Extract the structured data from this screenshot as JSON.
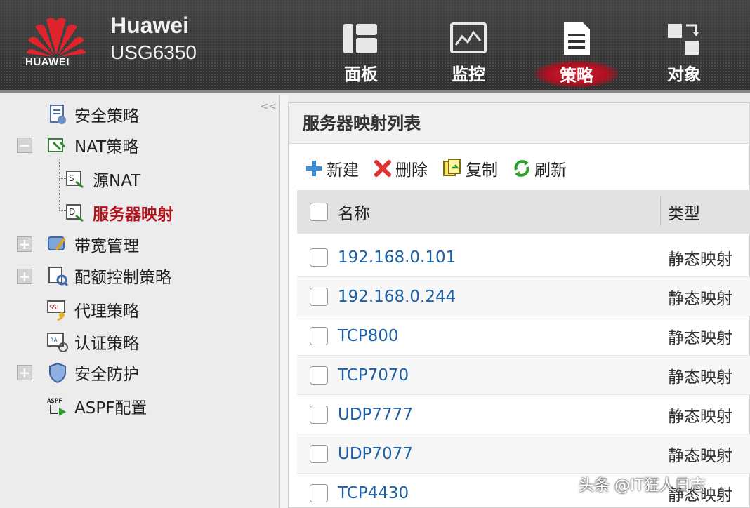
{
  "header": {
    "logo_text": "HUAWEI",
    "brand_name": "Huawei",
    "model": "USG6350",
    "nav": [
      {
        "label": "面板",
        "icon": "dashboard-icon",
        "active": false
      },
      {
        "label": "监控",
        "icon": "monitor-icon",
        "active": false
      },
      {
        "label": "策略",
        "icon": "policy-document-icon",
        "active": true
      },
      {
        "label": "对象",
        "icon": "object-icon",
        "active": false
      }
    ]
  },
  "sidebar": {
    "collapse_symbol": "<<",
    "items": [
      {
        "label": "安全策略",
        "icon": "security-policy-icon"
      },
      {
        "label": "NAT策略",
        "icon": "nat-policy-icon",
        "toggle": "−"
      },
      {
        "label": "源NAT",
        "icon": "source-nat-icon"
      },
      {
        "label": "服务器映射",
        "icon": "server-mapping-icon",
        "active": true
      },
      {
        "label": "带宽管理",
        "icon": "bandwidth-icon",
        "toggle": "+"
      },
      {
        "label": "配额控制策略",
        "icon": "quota-icon",
        "toggle": "+"
      },
      {
        "label": "代理策略",
        "icon": "ssl-proxy-icon"
      },
      {
        "label": "认证策略",
        "icon": "auth-icon"
      },
      {
        "label": "安全防护",
        "icon": "shield-icon",
        "toggle": "+"
      },
      {
        "label": "ASPF配置",
        "icon": "aspf-icon"
      }
    ]
  },
  "main": {
    "title": "服务器映射列表",
    "toolbar": {
      "new_label": "新建",
      "delete_label": "删除",
      "copy_label": "复制",
      "refresh_label": "刷新"
    },
    "table": {
      "columns": [
        "名称",
        "类型"
      ],
      "rows": [
        {
          "name": "192.168.0.101",
          "type": "静态映射"
        },
        {
          "name": "192.168.0.244",
          "type": "静态映射"
        },
        {
          "name": "TCP800",
          "type": "静态映射"
        },
        {
          "name": "TCP7070",
          "type": "静态映射"
        },
        {
          "name": "UDP7777",
          "type": "静态映射"
        },
        {
          "name": "UDP7077",
          "type": "静态映射"
        },
        {
          "name": "TCP4430",
          "type": "静态映射"
        }
      ]
    }
  },
  "watermark": "头条 @IT狂人日志",
  "colors": {
    "accent_red": "#b0121b",
    "link_blue": "#1a5fa8",
    "header_bg": "#3b3b3b"
  }
}
